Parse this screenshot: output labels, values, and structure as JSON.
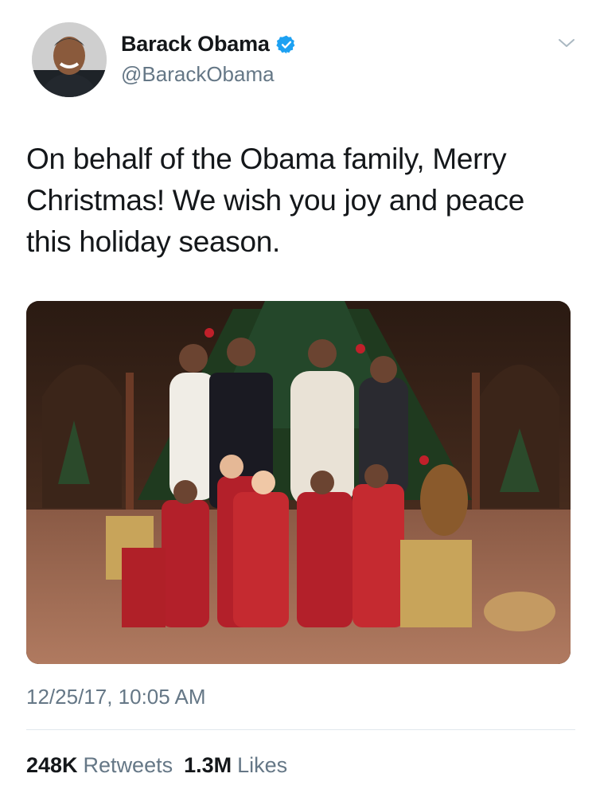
{
  "user": {
    "display_name": "Barack Obama",
    "handle": "@BarackObama",
    "verified": true,
    "avatar_icon": "profile-photo"
  },
  "tweet": {
    "text": "On behalf of the Obama family, Merry Christmas! We wish you joy and peace this holiday season.",
    "timestamp": "12/25/17, 10:05 AM",
    "media_icon": "family-christmas-photo"
  },
  "stats": {
    "retweets_count": "248K",
    "retweets_label": "Retweets",
    "likes_count": "1.3M",
    "likes_label": "Likes"
  },
  "menu": {
    "icon": "chevron-down-icon"
  },
  "colors": {
    "verified_blue": "#1da1f2",
    "secondary_text": "#657786",
    "primary_text": "#14171a",
    "divider": "#e1e8ed"
  }
}
